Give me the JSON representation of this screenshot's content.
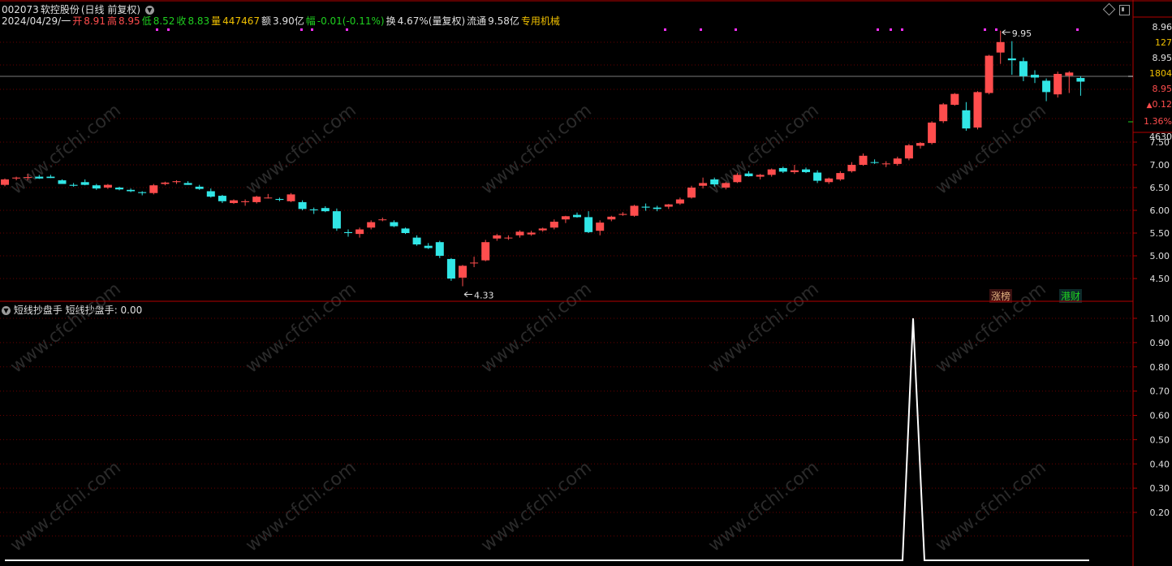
{
  "header": {
    "code": "002073",
    "name": "软控股份",
    "mode": "(日线 前复权)",
    "date": "2024/04/29/一",
    "open_label": "开",
    "open": "8.91",
    "high_label": "高",
    "high": "8.95",
    "low_label": "低",
    "low": "8.52",
    "close_label": "收",
    "close": "8.83",
    "vol_label": "量",
    "vol": "447467",
    "amt_label": "额",
    "amt": "3.90亿",
    "chg_label": "幅",
    "chg": "-0.01(-0.11%)",
    "turn_label": "换",
    "turn": "4.67%(量复权)",
    "float_label": "流通",
    "float": "9.58亿",
    "concept": "专用机械"
  },
  "indicator": {
    "name": "短线抄盘手",
    "label": "短线抄盘手",
    "value": "0.00"
  },
  "right_panel": {
    "r1": "8.96",
    "r2": "127",
    "r3": "8.95",
    "r4": "1804",
    "r5": "8.95",
    "r6": "0.12",
    "r7": "1.36%",
    "r8": "4630"
  },
  "annotations": {
    "low_label": "4.33",
    "high_label": "9.95",
    "tag_zhangbang": "涨榜",
    "tag_gangcai": "港财"
  },
  "watermark": "www.cfchi.com",
  "colors": {
    "up": "#ff4d4d",
    "down": "#31e6e6",
    "grid": "#6a0000",
    "axis": "#b40000",
    "text": "#e0e0e0",
    "yellow": "#f0c000",
    "green": "#1fd01f",
    "magenta": "#ff30ff"
  },
  "chart_data": [
    {
      "type": "candlestick",
      "price_axis_ticks": [
        4.5,
        5.0,
        5.5,
        6.0,
        6.5,
        7.0,
        7.5
      ],
      "ylim": [
        4.2,
        9.9
      ],
      "candles": [
        [
          6.56,
          6.7,
          6.53,
          6.68
        ],
        [
          6.7,
          6.74,
          6.66,
          6.72
        ],
        [
          6.73,
          6.8,
          6.66,
          6.73
        ],
        [
          6.74,
          6.78,
          6.69,
          6.7
        ],
        [
          6.74,
          6.78,
          6.71,
          6.71
        ],
        [
          6.66,
          6.68,
          6.58,
          6.58
        ],
        [
          6.56,
          6.6,
          6.52,
          6.54
        ],
        [
          6.62,
          6.68,
          6.55,
          6.56
        ],
        [
          6.55,
          6.58,
          6.45,
          6.48
        ],
        [
          6.5,
          6.58,
          6.47,
          6.56
        ],
        [
          6.5,
          6.52,
          6.44,
          6.46
        ],
        [
          6.45,
          6.48,
          6.4,
          6.42
        ],
        [
          6.4,
          6.42,
          6.33,
          6.38
        ],
        [
          6.38,
          6.58,
          6.35,
          6.55
        ],
        [
          6.58,
          6.63,
          6.55,
          6.61
        ],
        [
          6.62,
          6.66,
          6.58,
          6.64
        ],
        [
          6.6,
          6.64,
          6.56,
          6.56
        ],
        [
          6.52,
          6.56,
          6.45,
          6.47
        ],
        [
          6.42,
          6.48,
          6.28,
          6.3
        ],
        [
          6.32,
          6.34,
          6.16,
          6.2
        ],
        [
          6.16,
          6.24,
          6.14,
          6.22
        ],
        [
          6.18,
          6.24,
          6.1,
          6.2
        ],
        [
          6.18,
          6.32,
          6.15,
          6.3
        ],
        [
          6.28,
          6.36,
          6.26,
          6.28
        ],
        [
          6.25,
          6.28,
          6.2,
          6.23
        ],
        [
          6.2,
          6.38,
          6.18,
          6.35
        ],
        [
          6.18,
          6.22,
          6.0,
          6.03
        ],
        [
          6.02,
          6.06,
          5.92,
          6.0
        ],
        [
          6.05,
          6.09,
          5.96,
          5.98
        ],
        [
          5.98,
          6.04,
          5.55,
          5.6
        ],
        [
          5.52,
          5.58,
          5.42,
          5.5
        ],
        [
          5.48,
          5.62,
          5.4,
          5.58
        ],
        [
          5.62,
          5.78,
          5.58,
          5.74
        ],
        [
          5.8,
          5.84,
          5.76,
          5.8
        ],
        [
          5.74,
          5.78,
          5.63,
          5.65
        ],
        [
          5.6,
          5.62,
          5.48,
          5.5
        ],
        [
          5.4,
          5.45,
          5.22,
          5.25
        ],
        [
          5.22,
          5.28,
          5.15,
          5.17
        ],
        [
          5.3,
          5.33,
          4.95,
          5.0
        ],
        [
          4.93,
          4.95,
          4.45,
          4.5
        ],
        [
          4.52,
          4.8,
          4.33,
          4.78
        ],
        [
          4.85,
          4.98,
          4.75,
          4.85
        ],
        [
          4.9,
          5.35,
          4.88,
          5.3
        ],
        [
          5.38,
          5.48,
          5.33,
          5.45
        ],
        [
          5.4,
          5.45,
          5.35,
          5.4
        ],
        [
          5.45,
          5.56,
          5.4,
          5.53
        ],
        [
          5.47,
          5.55,
          5.44,
          5.51
        ],
        [
          5.56,
          5.62,
          5.53,
          5.6
        ],
        [
          5.62,
          5.8,
          5.58,
          5.75
        ],
        [
          5.8,
          5.88,
          5.72,
          5.87
        ],
        [
          5.9,
          5.95,
          5.84,
          5.85
        ],
        [
          5.85,
          5.98,
          5.5,
          5.52
        ],
        [
          5.55,
          5.78,
          5.45,
          5.73
        ],
        [
          5.8,
          5.88,
          5.76,
          5.86
        ],
        [
          5.9,
          5.96,
          5.88,
          5.92
        ],
        [
          5.88,
          6.12,
          5.86,
          6.1
        ],
        [
          6.08,
          6.15,
          5.99,
          6.06
        ],
        [
          6.06,
          6.1,
          5.98,
          6.03
        ],
        [
          6.08,
          6.14,
          6.03,
          6.13
        ],
        [
          6.15,
          6.28,
          6.12,
          6.24
        ],
        [
          6.28,
          6.54,
          6.26,
          6.5
        ],
        [
          6.54,
          6.72,
          6.48,
          6.6
        ],
        [
          6.68,
          6.72,
          6.52,
          6.57
        ],
        [
          6.5,
          6.62,
          6.46,
          6.6
        ],
        [
          6.62,
          6.82,
          6.6,
          6.78
        ],
        [
          6.81,
          6.86,
          6.74,
          6.75
        ],
        [
          6.74,
          6.8,
          6.68,
          6.78
        ],
        [
          6.78,
          6.92,
          6.74,
          6.9
        ],
        [
          6.93,
          6.96,
          6.82,
          6.85
        ],
        [
          6.84,
          7.0,
          6.8,
          6.88
        ],
        [
          6.9,
          6.94,
          6.82,
          6.84
        ],
        [
          6.83,
          6.88,
          6.6,
          6.65
        ],
        [
          6.62,
          6.72,
          6.58,
          6.7
        ],
        [
          6.68,
          6.86,
          6.65,
          6.82
        ],
        [
          6.86,
          7.06,
          6.83,
          7.0
        ],
        [
          7.0,
          7.25,
          6.98,
          7.2
        ],
        [
          7.06,
          7.12,
          7.02,
          7.05
        ],
        [
          7.02,
          7.08,
          6.95,
          7.03
        ],
        [
          7.02,
          7.18,
          6.98,
          7.14
        ],
        [
          7.14,
          7.46,
          7.1,
          7.43
        ],
        [
          7.42,
          7.5,
          7.36,
          7.48
        ],
        [
          7.48,
          7.96,
          7.45,
          7.93
        ],
        [
          7.96,
          8.36,
          7.92,
          8.33
        ],
        [
          8.32,
          8.58,
          8.3,
          8.56
        ],
        [
          8.2,
          8.38,
          7.75,
          7.8
        ],
        [
          7.82,
          8.62,
          7.78,
          8.6
        ],
        [
          8.58,
          9.42,
          8.55,
          9.4
        ],
        [
          9.47,
          9.95,
          9.22,
          9.7
        ],
        [
          9.34,
          9.72,
          8.98,
          9.3
        ],
        [
          9.28,
          9.36,
          8.84,
          8.95
        ],
        [
          8.98,
          9.08,
          8.8,
          8.92
        ],
        [
          8.85,
          8.9,
          8.4,
          8.6
        ],
        [
          8.55,
          9.05,
          8.48,
          9.0
        ],
        [
          8.96,
          9.06,
          8.58,
          9.03
        ],
        [
          8.91,
          8.95,
          8.52,
          8.83
        ]
      ]
    },
    {
      "type": "line",
      "title": "短线抄盘手",
      "y_ticks": [
        0.2,
        0.3,
        0.4,
        0.5,
        0.6,
        0.7,
        0.8,
        0.9,
        1.0
      ],
      "ylim": [
        0,
        1.0
      ],
      "x": [
        0,
        1,
        2,
        3
      ],
      "values": [
        0,
        0,
        1,
        0
      ]
    }
  ]
}
